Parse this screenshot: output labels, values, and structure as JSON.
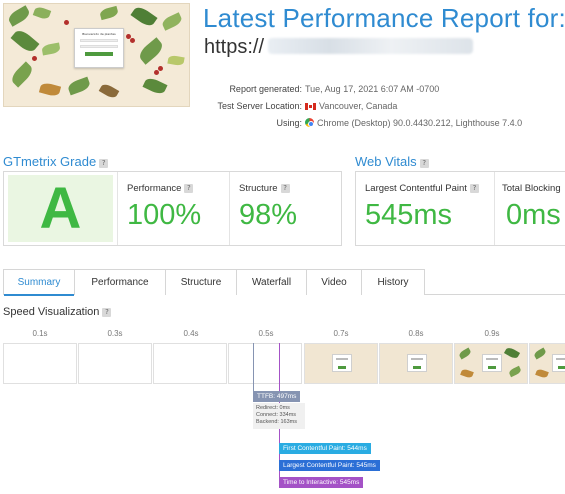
{
  "report": {
    "title": "Latest Performance Report for:",
    "url_prefix": "https://",
    "meta": [
      {
        "label": "Report generated:",
        "value": "Tue, Aug 17, 2021 6:07 AM -0700",
        "icon": ""
      },
      {
        "label": "Test Server Location:",
        "value": "Vancouver, Canada",
        "icon": "canada-flag-icon"
      },
      {
        "label": "Using:",
        "value": "Chrome (Desktop) 90.0.4430.212, Lighthouse 7.4.0",
        "icon": "chrome-icon"
      }
    ]
  },
  "thumbnail": {
    "card_title": "Bienvenido de plantas"
  },
  "grade": {
    "heading": "GTmetrix Grade",
    "help": "?",
    "letter": "A",
    "metrics": [
      {
        "label": "Performance",
        "value": "100%"
      },
      {
        "label": "Structure",
        "value": "98%"
      }
    ]
  },
  "vitals": {
    "heading": "Web Vitals",
    "help": "?",
    "metrics": [
      {
        "label": "Largest Contentful Paint",
        "value": "545ms"
      },
      {
        "label": "Total Blocking",
        "value": "0ms"
      }
    ]
  },
  "tabs": [
    "Summary",
    "Performance",
    "Structure",
    "Waterfall",
    "Video",
    "History"
  ],
  "active_tab": "Summary",
  "speed": {
    "title": "Speed Visualization",
    "help": "?",
    "ticks": [
      "0.1s",
      "0.3s",
      "0.4s",
      "0.5s",
      "0.7s",
      "0.8s",
      "0.9s"
    ],
    "markers": {
      "ttfb": "TTFB: 497ms",
      "ttfb_details": [
        "Redirect: 0ms",
        "Connect: 334ms",
        "Backend: 163ms"
      ],
      "fcp": "First Contentful Paint: 544ms",
      "lcp": "Largest Contentful Paint: 545ms",
      "tti": "Time to Interactive: 545ms"
    }
  },
  "colors": {
    "accent_blue": "#2f8bd1",
    "grade_green": "#3fb843",
    "ttfb": "#8694b2",
    "fcp": "#2aace2",
    "lcp": "#2b6fd6",
    "tti": "#a452c6"
  }
}
